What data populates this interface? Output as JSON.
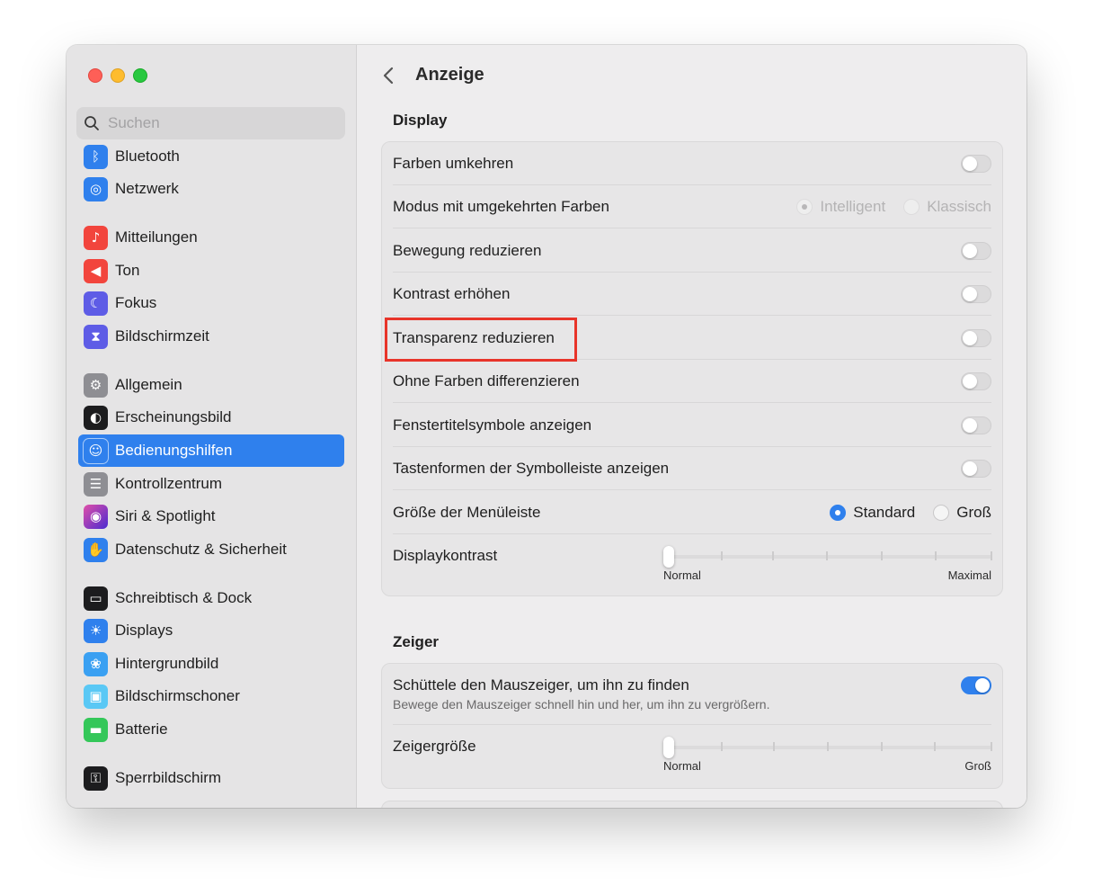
{
  "window": {
    "traffic_lights": [
      "close",
      "minimize",
      "zoom"
    ]
  },
  "sidebar": {
    "search_placeholder": "Suchen",
    "items": [
      {
        "label": "Bluetooth",
        "icon": "bluetooth-icon",
        "color": "#2f80ed",
        "glyph": "ᛒ"
      },
      {
        "label": "Netzwerk",
        "icon": "globe-icon",
        "color": "#2f80ed",
        "glyph": "🌐"
      },
      {
        "label": "Mitteilungen",
        "icon": "bell-icon",
        "color": "#f2453d",
        "glyph": "🔔"
      },
      {
        "label": "Ton",
        "icon": "speaker-icon",
        "color": "#f2453d",
        "glyph": "🔊"
      },
      {
        "label": "Fokus",
        "icon": "moon-icon",
        "color": "#5e5ce6",
        "glyph": "☾"
      },
      {
        "label": "Bildschirmzeit",
        "icon": "hourglass-icon",
        "color": "#5e5ce6",
        "glyph": "⧗"
      },
      {
        "label": "Allgemein",
        "icon": "gear-icon",
        "color": "#8e8e93",
        "glyph": "⚙"
      },
      {
        "label": "Erscheinungsbild",
        "icon": "appearance-icon",
        "color": "#1c1c1e",
        "glyph": "◐"
      },
      {
        "label": "Bedienungshilfen",
        "icon": "accessibility-icon",
        "color": "#2f80ed",
        "glyph": "♿"
      },
      {
        "label": "Kontrollzentrum",
        "icon": "switches-icon",
        "color": "#8e8e93",
        "glyph": "☰"
      },
      {
        "label": "Siri & Spotlight",
        "icon": "siri-icon",
        "color": "#7a3ad0",
        "glyph": "◉"
      },
      {
        "label": "Datenschutz & Sicherheit",
        "icon": "hand-icon",
        "color": "#2f80ed",
        "glyph": "✋"
      },
      {
        "label": "Schreibtisch & Dock",
        "icon": "dock-icon",
        "color": "#1c1c1e",
        "glyph": "▭"
      },
      {
        "label": "Displays",
        "icon": "sun-icon",
        "color": "#2f80ed",
        "glyph": "☀"
      },
      {
        "label": "Hintergrundbild",
        "icon": "flower-icon",
        "color": "#3aa0f2",
        "glyph": "❀"
      },
      {
        "label": "Bildschirmschoner",
        "icon": "screensaver-icon",
        "color": "#5ac8f5",
        "glyph": "▣"
      },
      {
        "label": "Batterie",
        "icon": "battery-icon",
        "color": "#34c759",
        "glyph": "▬"
      },
      {
        "label": "Sperrbildschirm",
        "icon": "lock-icon",
        "color": "#1c1c1e",
        "glyph": "🔒"
      }
    ]
  },
  "main": {
    "title": "Anzeige",
    "display_section": {
      "title": "Display",
      "rows": {
        "invert_colors": "Farben umkehren",
        "invert_mode": "Modus mit umgekehrten Farben",
        "invert_mode_options": [
          "Intelligent",
          "Klassisch"
        ],
        "reduce_motion": "Bewegung reduzieren",
        "increase_contrast": "Kontrast erhöhen",
        "reduce_transparency": "Transparenz reduzieren",
        "differentiate_without_color": "Ohne Farben differenzieren",
        "window_title_icons": "Fenstertitelsymbole anzeigen",
        "toolbar_button_shapes": "Tastenformen der Symbolleiste anzeigen",
        "menu_bar_size": "Größe der Menüleiste",
        "menu_bar_size_options": [
          "Standard",
          "Groß"
        ],
        "menu_bar_size_selected": "Standard",
        "display_contrast": "Displaykontrast",
        "display_contrast_min": "Normal",
        "display_contrast_max": "Maximal",
        "display_contrast_value": 0
      }
    },
    "pointer_section": {
      "title": "Zeiger",
      "shake_label": "Schüttele den Mauszeiger, um ihn zu finden",
      "shake_desc": "Bewege den Mauszeiger schnell hin und her, um ihn zu vergrößern.",
      "shake_enabled": true,
      "pointer_size": "Zeigergröße",
      "pointer_size_min": "Normal",
      "pointer_size_max": "Groß",
      "pointer_size_value": 0
    }
  },
  "colors": {
    "accent": "#2f80ed",
    "highlight": "#e8342a"
  }
}
